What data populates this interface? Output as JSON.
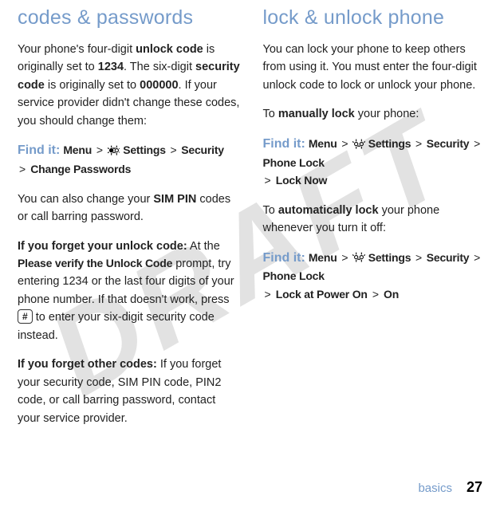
{
  "watermark": "DRAFT",
  "left": {
    "heading": "codes & passwords",
    "p1": {
      "t1": "Your phone's four-digit ",
      "b1": "unlock code",
      "t2": " is originally set to ",
      "b2": "1234",
      "t3": ". The six-digit ",
      "b3": "security code",
      "t4": " is originally set to ",
      "b4": "000000",
      "t5": ". If your service provider didn't change these codes, you should change them:"
    },
    "findit": "Find it:",
    "path1": {
      "m": "Menu",
      "s": "Settings",
      "sec": "Security",
      "cp": "Change Passwords"
    },
    "p2": {
      "t1": "You can also change your ",
      "b1": "SIM PIN",
      "t2": " codes or call barring password."
    },
    "p3": {
      "b1": "If you forget your unlock code:",
      "t1": " At the ",
      "m1": "Please verify the Unlock Code",
      "t2": " prompt, try entering 1234 or the last four digits of your phone number. If that doesn't work, press ",
      "key": "#",
      "t3": " to enter your six-digit security code instead."
    },
    "p4": {
      "b1": "If you forget other codes:",
      "t1": " If you forget your security code, SIM PIN code, PIN2 code, or call barring password, contact your service provider."
    }
  },
  "right": {
    "heading": "lock & unlock phone",
    "p1": "You can lock your phone to keep others from using it. You must enter the four-digit unlock code to lock or unlock your phone.",
    "p2": {
      "t1": "To ",
      "b1": "manually lock",
      "t2": " your phone:"
    },
    "findit": "Find it:",
    "path1": {
      "m": "Menu",
      "s": "Settings",
      "sec": "Security",
      "pl": "Phone Lock",
      "ln": "Lock Now"
    },
    "p3": {
      "t1": "To ",
      "b1": "automatically lock",
      "t2": " your phone whenever you turn it off:"
    },
    "path2": {
      "m": "Menu",
      "s": "Settings",
      "sec": "Security",
      "pl": "Phone Lock",
      "lp": "Lock at Power On",
      "on": "On"
    }
  },
  "footer": {
    "section": "basics",
    "page": "27"
  },
  "sep": ">"
}
